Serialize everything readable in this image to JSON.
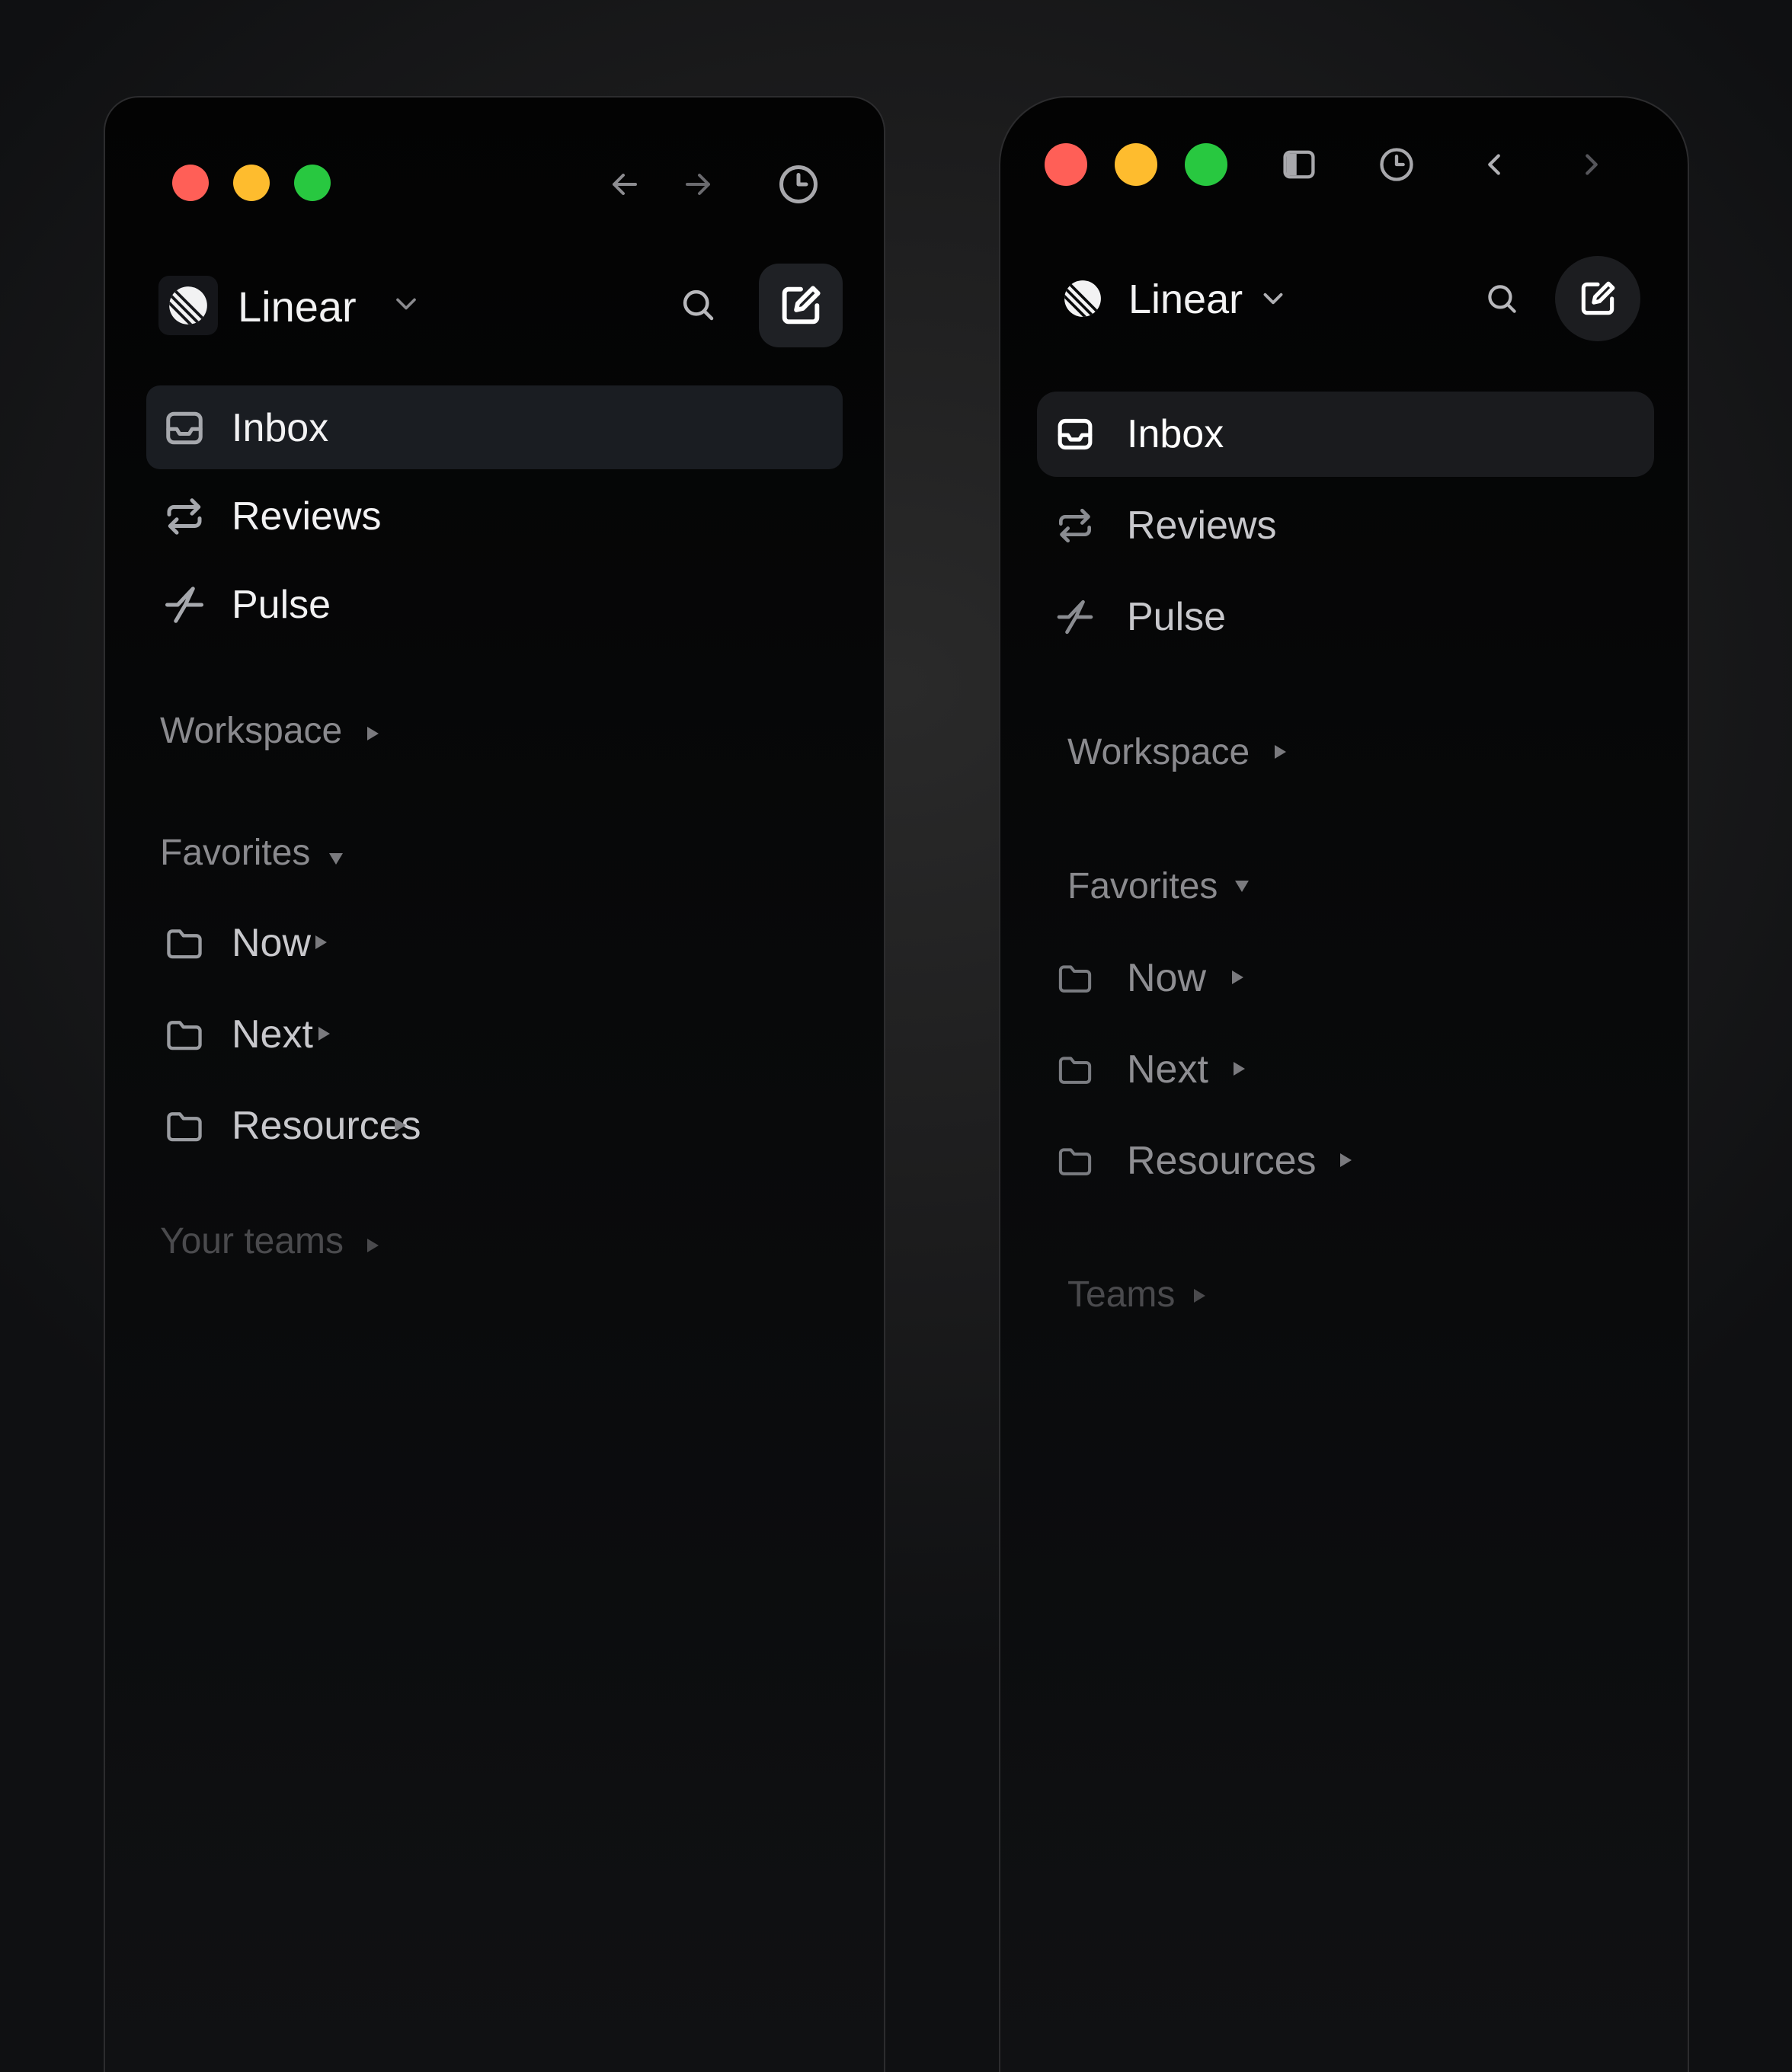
{
  "colors": {
    "close": "#ff5f57",
    "minimize": "#febc2e",
    "zoom": "#28c840",
    "active_bg": "#1a1d22",
    "text_primary": "#f2f2f3",
    "text_secondary": "#c8c8cc",
    "text_muted": "#8a8a8e",
    "text_faint": "#4a4a4d"
  },
  "left_window": {
    "traffic_lights": [
      "close",
      "minimize",
      "zoom"
    ],
    "toolbar_icons": [
      "arrow-left-icon",
      "arrow-right-icon",
      "clock-icon"
    ],
    "workspace": {
      "name": "Linear",
      "dropdown_icon": "chevron-down-icon"
    },
    "header_icons": [
      "search-icon",
      "compose-icon"
    ],
    "nav": [
      {
        "label": "Inbox",
        "icon": "inbox-icon",
        "active": true
      },
      {
        "label": "Reviews",
        "icon": "repeat-icon",
        "active": false
      },
      {
        "label": "Pulse",
        "icon": "pulse-icon",
        "active": false
      }
    ],
    "sections": {
      "workspace": "Workspace",
      "favorites": "Favorites",
      "teams": "Your teams"
    },
    "favorites": [
      {
        "label": "Now",
        "icon": "folder-icon"
      },
      {
        "label": "Next",
        "icon": "folder-icon"
      },
      {
        "label": "Resources",
        "icon": "folder-icon"
      }
    ]
  },
  "right_window": {
    "traffic_lights": [
      "close",
      "minimize",
      "zoom"
    ],
    "toolbar_icons": [
      "sidebar-toggle-icon",
      "clock-icon",
      "chevron-left-icon",
      "chevron-right-icon"
    ],
    "workspace": {
      "name": "Linear",
      "dropdown_icon": "chevron-down-icon"
    },
    "header_icons": [
      "search-icon",
      "compose-icon"
    ],
    "nav": [
      {
        "label": "Inbox",
        "icon": "inbox-icon",
        "active": true
      },
      {
        "label": "Reviews",
        "icon": "repeat-icon",
        "active": false
      },
      {
        "label": "Pulse",
        "icon": "pulse-icon",
        "active": false
      }
    ],
    "sections": {
      "workspace": "Workspace",
      "favorites": "Favorites",
      "teams": "Teams"
    },
    "favorites": [
      {
        "label": "Now",
        "icon": "folder-icon"
      },
      {
        "label": "Next",
        "icon": "folder-icon"
      },
      {
        "label": "Resources",
        "icon": "folder-icon"
      }
    ]
  }
}
